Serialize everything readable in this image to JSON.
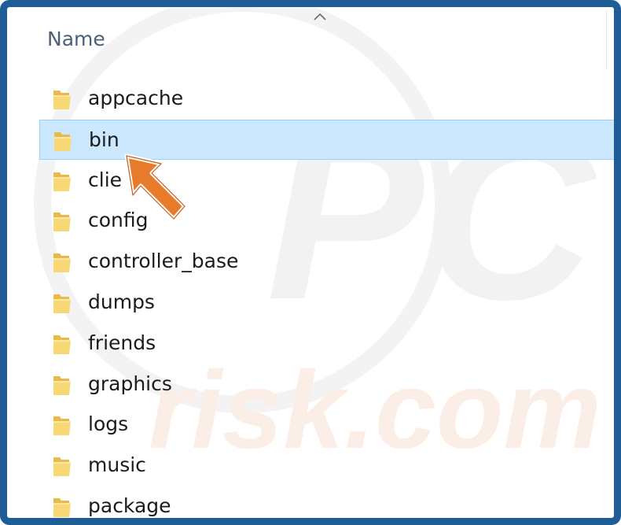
{
  "header": {
    "column_name": "Name",
    "sort_icon": "chevron-up-icon"
  },
  "watermark": {
    "text_top": "PC",
    "text_bottom": "risk.com"
  },
  "file_list": {
    "selected": "bin",
    "items": [
      {
        "label": "appcache",
        "icon": "folder-icon"
      },
      {
        "label": "bin",
        "icon": "folder-icon"
      },
      {
        "label": "clie",
        "icon": "folder-icon"
      },
      {
        "label": "config",
        "icon": "folder-icon"
      },
      {
        "label": "controller_base",
        "icon": "folder-icon"
      },
      {
        "label": "dumps",
        "icon": "folder-icon"
      },
      {
        "label": "friends",
        "icon": "folder-icon"
      },
      {
        "label": "graphics",
        "icon": "folder-icon"
      },
      {
        "label": "logs",
        "icon": "folder-icon"
      },
      {
        "label": "music",
        "icon": "folder-icon"
      },
      {
        "label": "package",
        "icon": "folder-icon"
      }
    ]
  },
  "colors": {
    "frame_border": "#1f5d96",
    "selection_fill": "#cce8ff",
    "selection_border": "#99d1ff",
    "folder_yellow": "#f8d775",
    "pointer_orange": "#e87a2c"
  }
}
